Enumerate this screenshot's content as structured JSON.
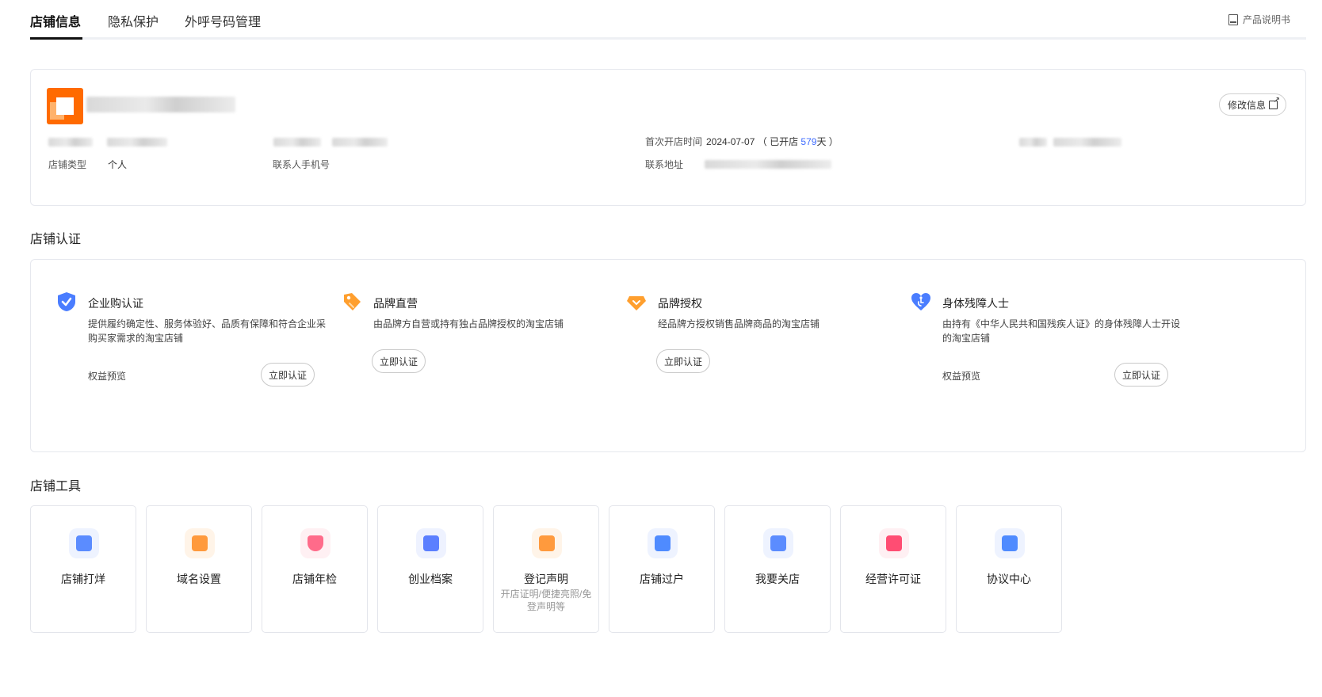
{
  "tabs": [
    {
      "label": "店铺信息",
      "active": true
    },
    {
      "label": "隐私保护",
      "active": false
    },
    {
      "label": "外呼号码管理",
      "active": false
    }
  ],
  "manual_link": "产品说明书",
  "store_info": {
    "edit_button": "修改信息",
    "fields": {
      "store_type_label": "店铺类型",
      "store_type_value": "个人",
      "contact_phone_label": "联系人手机号",
      "open_time_label": "首次开店时间",
      "open_date": "2024-07-07",
      "open_prefix": "（ 已开店 ",
      "open_days": "579",
      "open_suffix": "天 ）",
      "address_label": "联系地址"
    }
  },
  "certification": {
    "title": "店铺认证",
    "items": [
      {
        "title": "企业购认证",
        "desc": "提供履约确定性、服务体验好、品质有保障和符合企业采购买家需求的淘宝店铺",
        "benefit": "权益预览",
        "button": "立即认证",
        "icon": "blue-shield-check-icon"
      },
      {
        "title": "品牌直营",
        "desc": "由品牌方自营或持有独占品牌授权的淘宝店铺",
        "benefit": "",
        "button": "立即认证",
        "icon": "orange-tag-icon"
      },
      {
        "title": "品牌授权",
        "desc": "经品牌方授权销售品牌商品的淘宝店铺",
        "benefit": "",
        "button": "立即认证",
        "icon": "orange-diamond-icon"
      },
      {
        "title": "身体残障人士",
        "desc": "由持有《中华人民共和国残疾人证》的身体残障人士开设的淘宝店铺",
        "benefit": "权益预览",
        "button": "立即认证",
        "icon": "blue-heart-icon"
      }
    ]
  },
  "tools": {
    "title": "店铺工具",
    "items": [
      {
        "label": "店铺打烊",
        "sub": "",
        "icon": "store-close-icon",
        "color": "#5b8cff"
      },
      {
        "label": "域名设置",
        "sub": "",
        "icon": "domain-icon",
        "color": "#ff9a3d"
      },
      {
        "label": "店铺年检",
        "sub": "",
        "icon": "shield-search-icon",
        "color": "#ff6b8a"
      },
      {
        "label": "创业档案",
        "sub": "",
        "icon": "archive-icon",
        "color": "#5b7fff"
      },
      {
        "label": "登记声明",
        "sub": "开店证明/便捷亮照/免登声明等",
        "icon": "document-icon",
        "color": "#ff9a3d"
      },
      {
        "label": "店铺过户",
        "sub": "",
        "icon": "transfer-icon",
        "color": "#4f8bff"
      },
      {
        "label": "我要关店",
        "sub": "",
        "icon": "card-icon",
        "color": "#5b8cff"
      },
      {
        "label": "经营许可证",
        "sub": "",
        "icon": "license-icon",
        "color": "#ff4d73"
      },
      {
        "label": "协议中心",
        "sub": "",
        "icon": "agreement-icon",
        "color": "#4f8bff"
      }
    ]
  }
}
